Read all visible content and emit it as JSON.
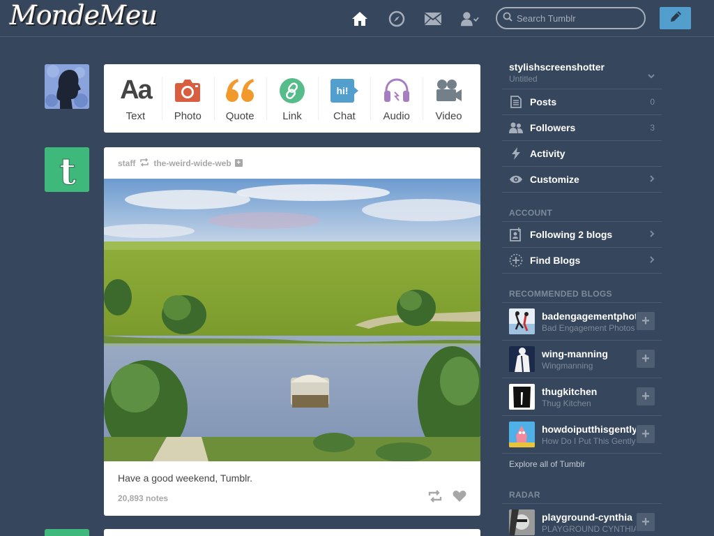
{
  "header": {
    "logo": "MondeMeu",
    "search_placeholder": "Search Tumblr",
    "nav_icons": [
      "home-icon",
      "compass-icon",
      "mail-icon",
      "account-icon"
    ],
    "compose_icon": "pencil-icon"
  },
  "post_types": [
    {
      "label": "Text",
      "icon": "text-icon",
      "color": "#444444"
    },
    {
      "label": "Photo",
      "icon": "camera-icon",
      "color": "#d95e40"
    },
    {
      "label": "Quote",
      "icon": "quote-icon",
      "color": "#f2992e"
    },
    {
      "label": "Link",
      "icon": "link-icon",
      "color": "#56bc8a"
    },
    {
      "label": "Chat",
      "icon": "chat-icon",
      "color": "#529ecc"
    },
    {
      "label": "Audio",
      "icon": "headphones-icon",
      "color": "#a77dc2"
    },
    {
      "label": "Video",
      "icon": "video-camera-icon",
      "color": "#748089"
    }
  ],
  "post": {
    "author": "staff",
    "reblogged_from": "the-weird-wide-web",
    "caption": "Have a good weekend, Tumblr.",
    "notes": "20,893 notes"
  },
  "sidebar": {
    "blog_name": "stylishscreenshotter",
    "blog_title": "Untitled",
    "items": [
      {
        "label": "Posts",
        "count": "0",
        "icon": "posts-icon"
      },
      {
        "label": "Followers",
        "count": "3",
        "icon": "followers-icon"
      },
      {
        "label": "Activity",
        "count": "",
        "icon": "lightning-icon"
      },
      {
        "label": "Customize",
        "count": "",
        "icon": "eye-icon"
      }
    ],
    "account_heading": "ACCOUNT",
    "account_items": [
      {
        "label": "Following 2 blogs",
        "icon": "following-icon"
      },
      {
        "label": "Find Blogs",
        "icon": "find-blogs-icon"
      }
    ],
    "recommended_heading": "RECOMMENDED BLOGS",
    "recommended": [
      {
        "name": "badengagementphotos",
        "title": "Bad Engagement Photos"
      },
      {
        "name": "wing-manning",
        "title": "Wingmanning"
      },
      {
        "name": "thugkitchen",
        "title": "Thug Kitchen"
      },
      {
        "name": "howdoiputthisgently",
        "title": "How Do I Put This Gently"
      }
    ],
    "explore": "Explore all of Tumblr",
    "radar_heading": "RADAR",
    "radar": {
      "name": "playground-cynthia",
      "title": "PLAYGROUND CYNTHIA"
    }
  }
}
